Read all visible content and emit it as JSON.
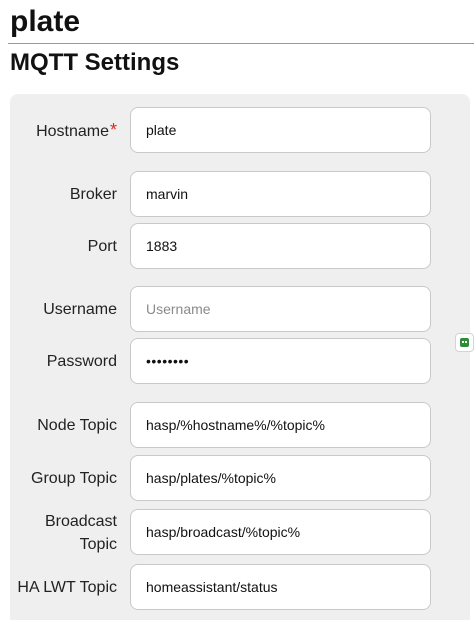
{
  "page": {
    "device_title": "plate",
    "section_title": "MQTT Settings"
  },
  "form": {
    "hostname": {
      "label": "Hostname",
      "required_mark": "*",
      "value": "plate"
    },
    "broker": {
      "label": "Broker",
      "value": "marvin"
    },
    "port": {
      "label": "Port",
      "value": "1883"
    },
    "username": {
      "label": "Username",
      "value": "",
      "placeholder": "Username"
    },
    "password": {
      "label": "Password",
      "value": "••••••••"
    },
    "node_topic": {
      "label": "Node Topic",
      "value": "hasp/%hostname%/%topic%"
    },
    "group_topic": {
      "label": "Group Topic",
      "value": "hasp/plates/%topic%"
    },
    "broadcast_topic": {
      "label_line1": "Broadcast",
      "label_line2": "Topic",
      "value": "hasp/broadcast/%topic%"
    },
    "ha_lwt_topic": {
      "label": "HA LWT Topic",
      "value": "homeassistant/status"
    }
  },
  "icons": {
    "password_manager": "password-manager-icon",
    "accent": "#2e8b3a",
    "required_color": "#e0271b"
  }
}
